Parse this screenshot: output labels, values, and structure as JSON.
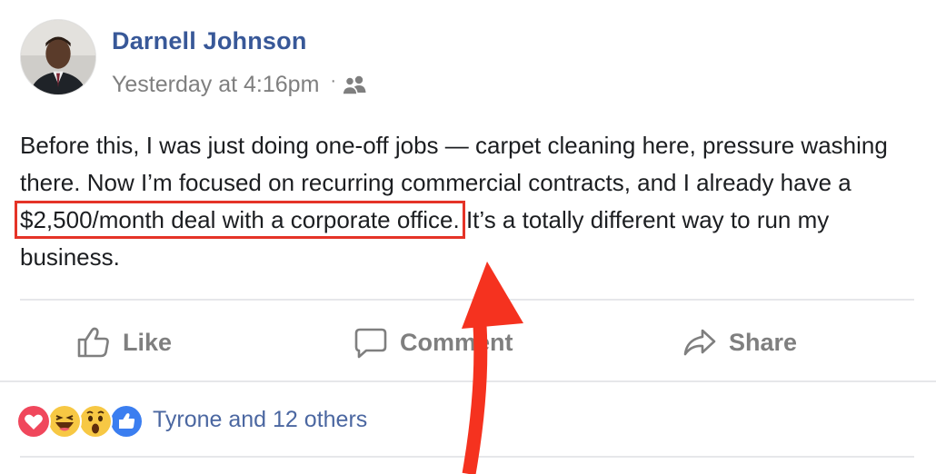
{
  "post": {
    "author": "Darnell Johnson",
    "timestamp": "Yesterday at 4:16pm",
    "separator": "·",
    "audience_icon": "friends-icon",
    "text_before": "Before this, I was just doing one-off jobs — carpet cleaning here, pressure washing there. Now I’m focused on recurring commercial contracts, and I already have a ",
    "text_highlight": "$2,500/month deal with a corporate office.",
    "text_after": " It’s a totally different way to run my business."
  },
  "actions": {
    "like_label": "Like",
    "comment_label": "Comment",
    "share_label": "Share"
  },
  "reactions": {
    "icons": [
      "love-icon",
      "haha-icon",
      "wow-icon",
      "like-icon"
    ],
    "summary": "Tyrone and 12 others"
  },
  "colors": {
    "author": "#385898",
    "meta": "#7f7f7f",
    "highlight_box": "#e53327",
    "arrow": "#f5321f",
    "link": "#4b67a1"
  }
}
